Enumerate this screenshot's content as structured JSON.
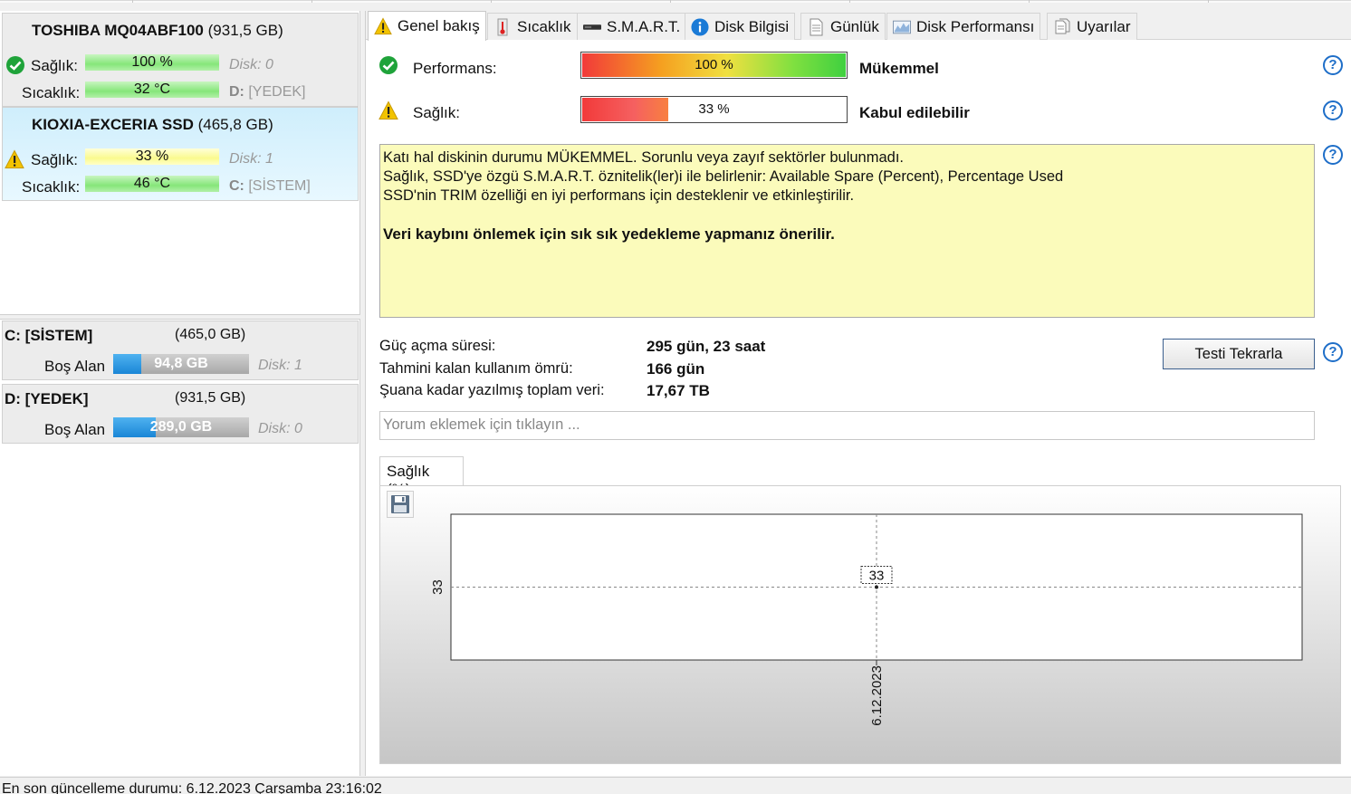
{
  "disks": [
    {
      "name": "TOSHIBA MQ04ABF100",
      "size": "(931,5 GB)",
      "health_label": "Sağlık:",
      "health_value": "100 %",
      "health_fraction": 1.0,
      "disk_meta": "Disk: 0",
      "temp_label": "Sıcaklık:",
      "temp_value": "32 °C",
      "partition_letter": "D:",
      "partition_name": "[YEDEK]",
      "status_icon": "check-circle-icon",
      "status_color": "#1fa33a"
    },
    {
      "name": "KIOXIA-EXCERIA SSD",
      "size": "(465,8 GB)",
      "health_label": "Sağlık:",
      "health_value": "33 %",
      "health_fraction": 0.33,
      "disk_meta": "Disk: 1",
      "temp_label": "Sıcaklık:",
      "temp_value": "46 °C",
      "partition_letter": "C:",
      "partition_name": "[SİSTEM]",
      "status_icon": "warning-icon",
      "status_color": "#f2c300",
      "selected": true
    }
  ],
  "partitions": [
    {
      "name": "C: [SİSTEM]",
      "size": "(465,0 GB)",
      "free_label": "Boş Alan",
      "free_value": "94,8 GB",
      "free_fraction": 0.204,
      "disk_meta": "Disk: 1"
    },
    {
      "name": "D: [YEDEK]",
      "size": "(931,5 GB)",
      "free_label": "Boş Alan",
      "free_value": "289,0 GB",
      "free_fraction": 0.31,
      "disk_meta": "Disk: 0"
    }
  ],
  "tabs": [
    {
      "label": "Genel bakış",
      "icon": "warning-icon",
      "active": true
    },
    {
      "label": "Sıcaklık",
      "icon": "thermometer-icon"
    },
    {
      "label": "S.M.A.R.T.",
      "icon": "drive-icon"
    },
    {
      "label": "Disk Bilgisi",
      "icon": "info-icon"
    },
    {
      "label": "Günlük",
      "icon": "document-icon"
    },
    {
      "label": "Disk Performansı",
      "icon": "performance-chart-icon"
    },
    {
      "label": "Uyarılar",
      "icon": "alerts-icon"
    }
  ],
  "overview": {
    "performance_label": "Performans:",
    "performance_value": "100 %",
    "performance_fraction": 1.0,
    "performance_verdict": "Mükemmel",
    "health_label": "Sağlık:",
    "health_value": "33 %",
    "health_fraction": 0.33,
    "health_verdict": "Kabul edilebilir",
    "message_lines": [
      "Katı hal diskinin durumu MÜKEMMEL. Sorunlu veya zayıf sektörler bulunmadı.",
      "Sağlık, SSD'ye özgü S.M.A.R.T. öznitelik(ler)i ile belirlenir:  Available Spare (Percent), Percentage Used",
      "SSD'nin TRIM özelliği en iyi performans için desteklenir ve etkinleştirilir."
    ],
    "message_warning": "Veri kaybını önlemek için sık sık yedekleme yapmanız önerilir.",
    "power_on_label": "Güç açma süresi:",
    "power_on_value": "295 gün, 23 saat",
    "remaining_life_label": "Tahmini kalan kullanım ömrü:",
    "remaining_life_value": "166 gün",
    "total_written_label": "Şuana kadar yazılmış toplam veri:",
    "total_written_value": "17,67 TB",
    "retest_button": "Testi Tekrarla",
    "comment_placeholder": "Yorum eklemek için tıklayın ...",
    "help_symbol": "?"
  },
  "chart_tab_label": "Sağlık (%)",
  "chart_data": {
    "type": "line",
    "title": "",
    "xlabel": "",
    "ylabel": "",
    "x": [
      "6.12.2023"
    ],
    "series": [
      {
        "values": [
          33
        ]
      }
    ],
    "y_tick_labels": [
      "33"
    ],
    "x_tick_labels": [
      "6.12.2023"
    ],
    "data_labels": [
      "33"
    ],
    "grid": true,
    "background_colors": [
      "#ffffff",
      "#c6c6c6"
    ]
  },
  "status_bar": "En son güncelleme durumu: 6.12.2023 Çarşamba 23:16:02",
  "colors": {
    "good_green": "#86e67a",
    "warn_yellow": "#fafa8e",
    "free_blue": "#1a86d6",
    "help_blue": "#1e6ec8",
    "message_bg": "#fbfbbb"
  }
}
